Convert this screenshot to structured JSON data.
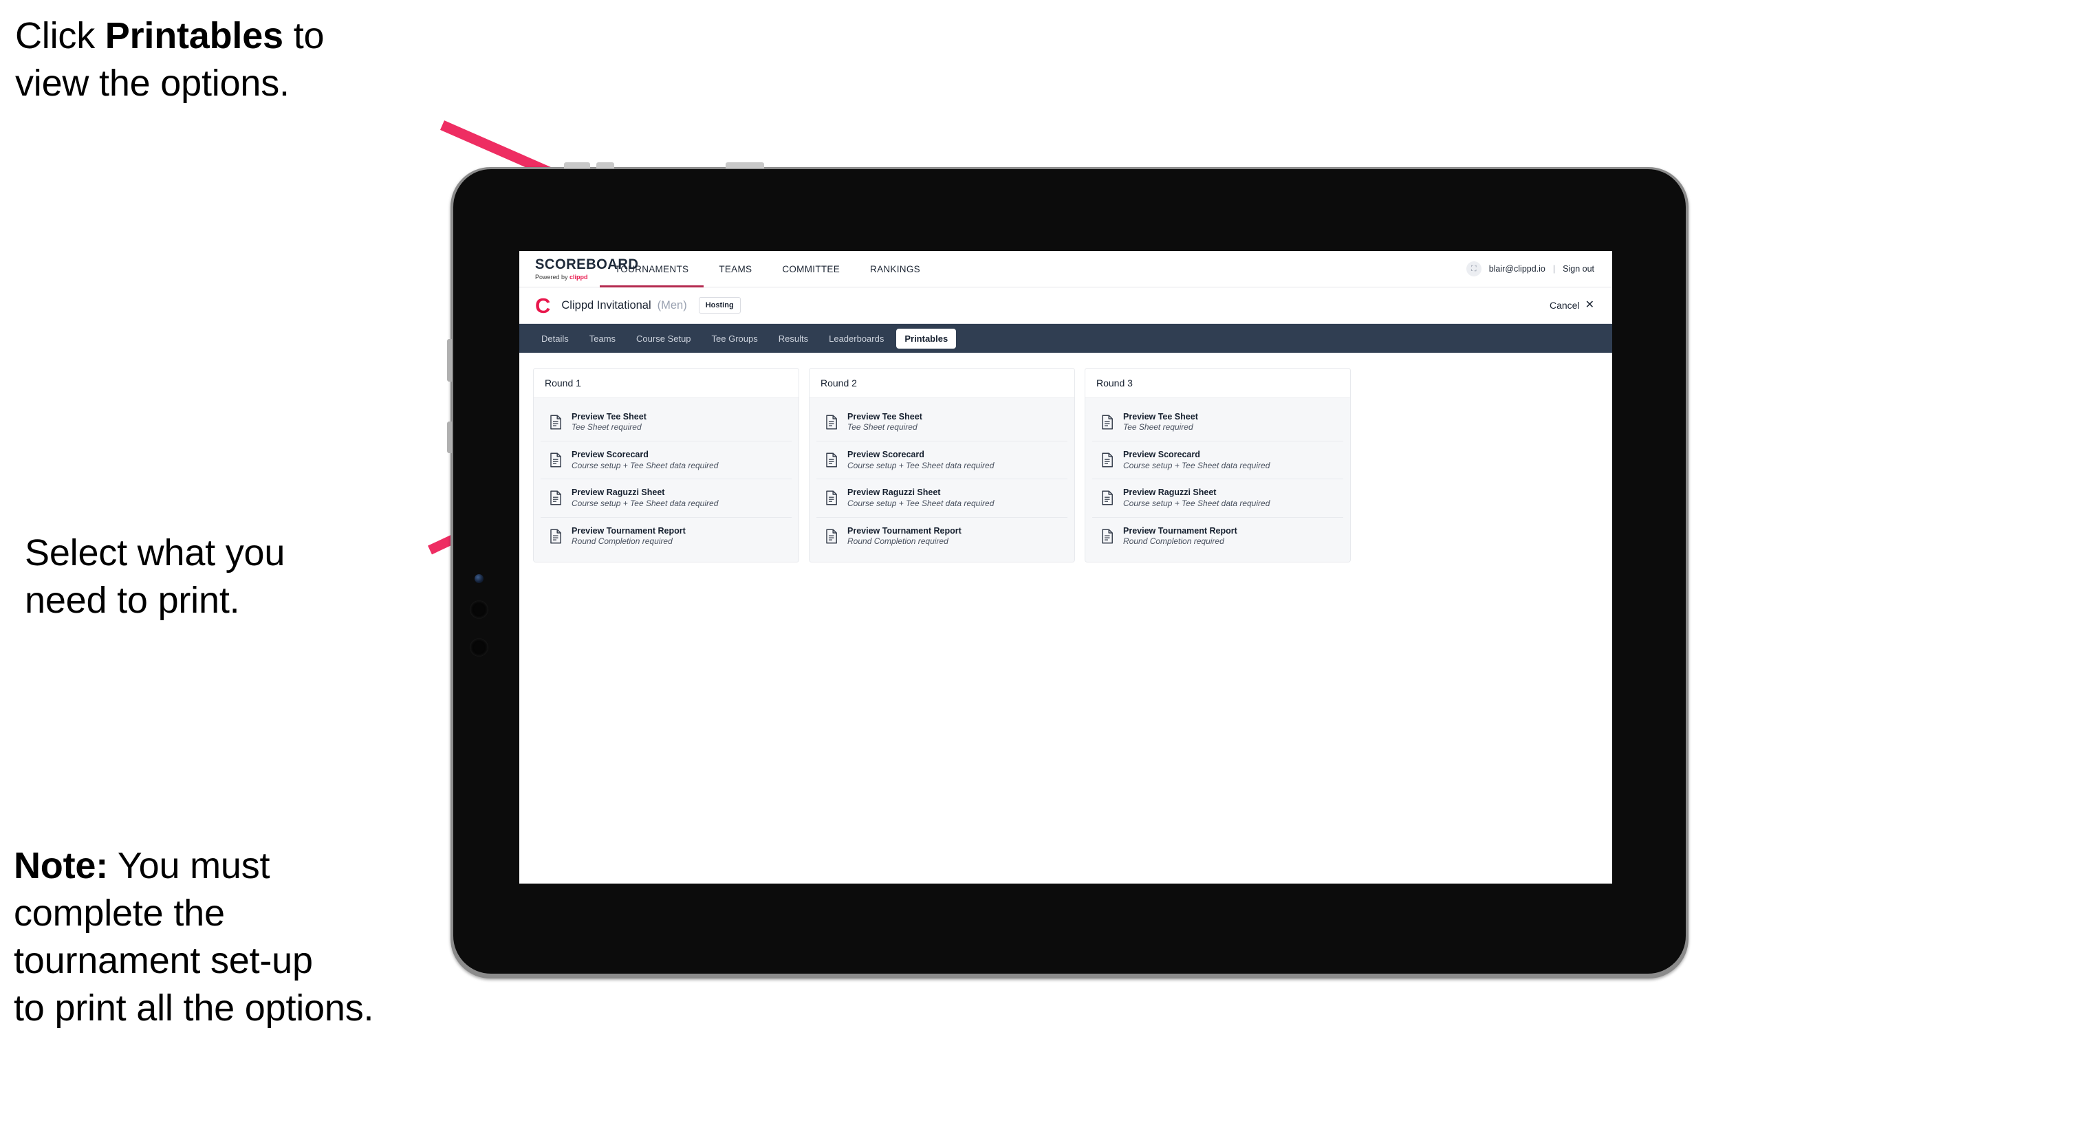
{
  "callouts": [
    {
      "id": "c1",
      "prefix": "Click ",
      "bold": "Printables",
      "suffix": " to\nview the options."
    },
    {
      "id": "c2",
      "prefix": "Select what you\n need to print.",
      "bold": "",
      "suffix": ""
    },
    {
      "id": "c3",
      "prefix": "",
      "bold": "Note:",
      "suffix": " You must\ncomplete the\ntournament set-up\nto print all the options."
    }
  ],
  "colors": {
    "accent_pink": "#ee2d62",
    "brand_red": "#e8174c",
    "subnav_navy": "#303e52",
    "tab_underline": "#b4294f",
    "card_bg": "#f6f7f9"
  },
  "app": {
    "logo": {
      "main": "SCOREBOARD",
      "sub_prefix": "Powered by ",
      "sub_brand": "clippd"
    },
    "top_nav": [
      {
        "label": "TOURNAMENTS",
        "active": true
      },
      {
        "label": "TEAMS",
        "active": false
      },
      {
        "label": "COMMITTEE",
        "active": false
      },
      {
        "label": "RANKINGS",
        "active": false
      }
    ],
    "account": {
      "avatar_glyph": "⛶",
      "email": "blair@clippd.io",
      "separator": "|",
      "sign_out": "Sign out"
    },
    "tournament": {
      "logo_letter": "C",
      "name": "Clippd Invitational",
      "gender": "(Men)",
      "status_chip": "Hosting",
      "cancel_label": "Cancel",
      "cancel_icon": "✕"
    },
    "sub_nav": [
      {
        "label": "Details",
        "active": false
      },
      {
        "label": "Teams",
        "active": false
      },
      {
        "label": "Course Setup",
        "active": false
      },
      {
        "label": "Tee Groups",
        "active": false
      },
      {
        "label": "Results",
        "active": false
      },
      {
        "label": "Leaderboards",
        "active": false
      },
      {
        "label": "Printables",
        "active": true
      }
    ],
    "rounds": [
      {
        "title": "Round 1",
        "items": [
          {
            "title": "Preview Tee Sheet",
            "sub": "Tee Sheet required"
          },
          {
            "title": "Preview Scorecard",
            "sub": "Course setup + Tee Sheet data required"
          },
          {
            "title": "Preview Raguzzi Sheet",
            "sub": "Course setup + Tee Sheet data required"
          },
          {
            "title": "Preview Tournament Report",
            "sub": "Round Completion required"
          }
        ]
      },
      {
        "title": "Round 2",
        "items": [
          {
            "title": "Preview Tee Sheet",
            "sub": "Tee Sheet required"
          },
          {
            "title": "Preview Scorecard",
            "sub": "Course setup + Tee Sheet data required"
          },
          {
            "title": "Preview Raguzzi Sheet",
            "sub": "Course setup + Tee Sheet data required"
          },
          {
            "title": "Preview Tournament Report",
            "sub": "Round Completion required"
          }
        ]
      },
      {
        "title": "Round 3",
        "items": [
          {
            "title": "Preview Tee Sheet",
            "sub": "Tee Sheet required"
          },
          {
            "title": "Preview Scorecard",
            "sub": "Course setup + Tee Sheet data required"
          },
          {
            "title": "Preview Raguzzi Sheet",
            "sub": "Course setup + Tee Sheet data required"
          },
          {
            "title": "Preview Tournament Report",
            "sub": "Round Completion required"
          }
        ]
      }
    ]
  }
}
